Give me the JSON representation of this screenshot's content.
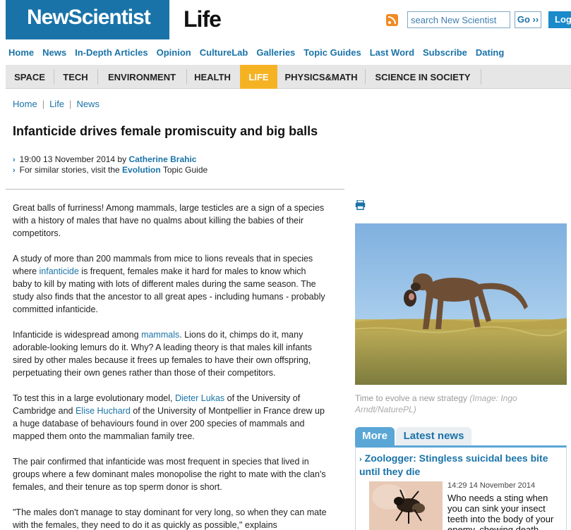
{
  "header": {
    "logo_text": "NewScientist",
    "section_title": "Life",
    "search_placeholder": "search New Scientist",
    "go_label": "Go ››",
    "login_label": "Log"
  },
  "topnav": [
    "Home",
    "News",
    "In-Depth Articles",
    "Opinion",
    "CultureLab",
    "Galleries",
    "Topic Guides",
    "Last Word",
    "Subscribe",
    "Dating"
  ],
  "categories": [
    "SPACE",
    "TECH",
    "ENVIRONMENT",
    "HEALTH",
    "LIFE",
    "PHYSICS&MATH",
    "SCIENCE IN SOCIETY"
  ],
  "active_category": "LIFE",
  "colors": {
    "brand_blue": "#1a73a8",
    "active_tab": "#f5b324",
    "rss": "#f08a24"
  },
  "breadcrumb": [
    "Home",
    "Life",
    "News"
  ],
  "article": {
    "headline": "Infanticide drives female promiscuity and big balls",
    "date": "19:00 13 November 2014 by ",
    "author": "Catherine Brahic",
    "similar_prefix": "For similar stories, visit the ",
    "topic": "Evolution",
    "similar_suffix": " Topic Guide",
    "p1": "Great balls of furriness! Among mammals, large testicles are a sign of a species with a history of males that have no qualms about killing the babies of their competitors.",
    "p2_a": "A study of more than 200 mammals from mice to lions reveals that in species where ",
    "p2_link": "infanticide",
    "p2_b": " is frequent, females make it hard for males to know which baby to kill by mating with lots of different males during the same season. The study also finds that the ancestor to all great apes - including humans - probably committed infanticide.",
    "p3_a": "Infanticide is widespread among ",
    "p3_link": "mammals",
    "p3_b": ". Lions do it, chimps do it, many adorable-looking lemurs do it. Why? A leading theory is that males kill infants sired by other males because it frees up females to have their own offspring, perpetuating their own genes rather than those of their competitors.",
    "p4_a": "To test this in a large evolutionary model, ",
    "p4_link1": "Dieter Lukas",
    "p4_b": " of the University of Cambridge and ",
    "p4_link2": "Elise Huchard",
    "p4_c": " of the University of Montpellier in France drew up a huge database of behaviours found in over 200 species of mammals and mapped them onto the mammalian family tree.",
    "p5": "The pair confirmed that infanticide was most frequent in species that lived in groups where a few dominant males monopolise the right to mate with the clan's females, and their tenure as top sperm donor is short.",
    "p6": "\"The males don't manage to stay dominant for very long, so when they can mate with the females, they need to do it as quickly as possible,\" explains"
  },
  "photo": {
    "caption": "Time to evolve a new strategy",
    "credit": "(Image: Ingo Arndt/NaturePL)"
  },
  "sidebar": {
    "tab_more": "More",
    "tab_latest": "Latest news",
    "story_title": "Zoologger: Stingless suicidal bees bite until they die",
    "story_time": "14:29 14 November 2014",
    "story_text": "Who needs a sting when you can sink your insect teeth into the body of your enemy, chewing death"
  }
}
